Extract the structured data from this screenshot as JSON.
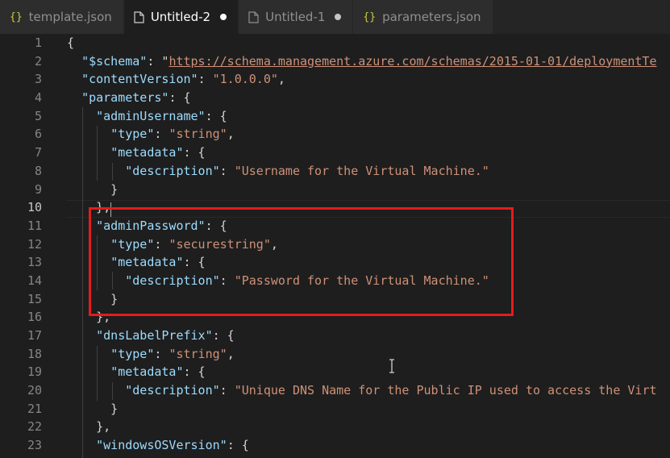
{
  "tabs": [
    {
      "label": "template.json",
      "icon": "json-braces-icon",
      "icon_text": "{}",
      "active": false,
      "dirty": false
    },
    {
      "label": "Untitled-2",
      "icon": "file-icon",
      "active": true,
      "dirty": true
    },
    {
      "label": "Untitled-1",
      "icon": "file-icon",
      "active": false,
      "dirty": true
    },
    {
      "label": "parameters.json",
      "icon": "json-braces-icon",
      "icon_text": "{}",
      "active": false,
      "dirty": false
    }
  ],
  "editor": {
    "current_line": 10,
    "highlighted_lines": [
      11,
      15
    ],
    "lines": [
      {
        "n": "1",
        "tokens": [
          [
            "p",
            "{"
          ]
        ]
      },
      {
        "n": "2",
        "tokens": [
          [
            "p",
            "  "
          ],
          [
            "k",
            "\"$schema\""
          ],
          [
            "p",
            ": \""
          ],
          [
            "su",
            "https://schema.management.azure.com/schemas/2015-01-01/deploymentTe"
          ]
        ]
      },
      {
        "n": "3",
        "tokens": [
          [
            "p",
            "  "
          ],
          [
            "k",
            "\"contentVersion\""
          ],
          [
            "p",
            ": "
          ],
          [
            "s",
            "\"1.0.0.0\""
          ],
          [
            "p",
            ","
          ]
        ]
      },
      {
        "n": "4",
        "tokens": [
          [
            "p",
            "  "
          ],
          [
            "k",
            "\"parameters\""
          ],
          [
            "p",
            ": {"
          ]
        ]
      },
      {
        "n": "5",
        "tokens": [
          [
            "p",
            "    "
          ],
          [
            "k",
            "\"adminUsername\""
          ],
          [
            "p",
            ": {"
          ]
        ]
      },
      {
        "n": "6",
        "tokens": [
          [
            "p",
            "      "
          ],
          [
            "k",
            "\"type\""
          ],
          [
            "p",
            ": "
          ],
          [
            "s",
            "\"string\""
          ],
          [
            "p",
            ","
          ]
        ]
      },
      {
        "n": "7",
        "tokens": [
          [
            "p",
            "      "
          ],
          [
            "k",
            "\"metadata\""
          ],
          [
            "p",
            ": {"
          ]
        ]
      },
      {
        "n": "8",
        "tokens": [
          [
            "p",
            "        "
          ],
          [
            "k",
            "\"description\""
          ],
          [
            "p",
            ": "
          ],
          [
            "s",
            "\"Username for the Virtual Machine.\""
          ]
        ]
      },
      {
        "n": "9",
        "tokens": [
          [
            "p",
            "      }"
          ]
        ]
      },
      {
        "n": "10",
        "tokens": [
          [
            "p",
            "    },"
          ]
        ]
      },
      {
        "n": "11",
        "tokens": [
          [
            "p",
            "    "
          ],
          [
            "k",
            "\"adminPassword\""
          ],
          [
            "p",
            ": {"
          ]
        ]
      },
      {
        "n": "12",
        "tokens": [
          [
            "p",
            "      "
          ],
          [
            "k",
            "\"type\""
          ],
          [
            "p",
            ": "
          ],
          [
            "s",
            "\"securestring\""
          ],
          [
            "p",
            ","
          ]
        ]
      },
      {
        "n": "13",
        "tokens": [
          [
            "p",
            "      "
          ],
          [
            "k",
            "\"metadata\""
          ],
          [
            "p",
            ": {"
          ]
        ]
      },
      {
        "n": "14",
        "tokens": [
          [
            "p",
            "        "
          ],
          [
            "k",
            "\"description\""
          ],
          [
            "p",
            ": "
          ],
          [
            "s",
            "\"Password for the Virtual Machine.\""
          ]
        ]
      },
      {
        "n": "15",
        "tokens": [
          [
            "p",
            "      }"
          ]
        ]
      },
      {
        "n": "16",
        "tokens": [
          [
            "p",
            "    },"
          ]
        ]
      },
      {
        "n": "17",
        "tokens": [
          [
            "p",
            "    "
          ],
          [
            "k",
            "\"dnsLabelPrefix\""
          ],
          [
            "p",
            ": {"
          ]
        ]
      },
      {
        "n": "18",
        "tokens": [
          [
            "p",
            "      "
          ],
          [
            "k",
            "\"type\""
          ],
          [
            "p",
            ": "
          ],
          [
            "s",
            "\"string\""
          ],
          [
            "p",
            ","
          ]
        ]
      },
      {
        "n": "19",
        "tokens": [
          [
            "p",
            "      "
          ],
          [
            "k",
            "\"metadata\""
          ],
          [
            "p",
            ": {"
          ]
        ]
      },
      {
        "n": "20",
        "tokens": [
          [
            "p",
            "        "
          ],
          [
            "k",
            "\"description\""
          ],
          [
            "p",
            ": "
          ],
          [
            "s",
            "\"Unique DNS Name for the Public IP used to access the Virt"
          ]
        ]
      },
      {
        "n": "21",
        "tokens": [
          [
            "p",
            "      }"
          ]
        ]
      },
      {
        "n": "22",
        "tokens": [
          [
            "p",
            "    },"
          ]
        ]
      },
      {
        "n": "23",
        "tokens": [
          [
            "p",
            "    "
          ],
          [
            "k",
            "\"windowsOSVersion\""
          ],
          [
            "p",
            ": {"
          ]
        ]
      }
    ]
  },
  "colors": {
    "background": "#1e1e1e",
    "key": "#9cdcfe",
    "string": "#ce9178",
    "punctuation": "#d4d4d4",
    "line_number": "#858585",
    "highlight_box": "#e51b1b"
  }
}
